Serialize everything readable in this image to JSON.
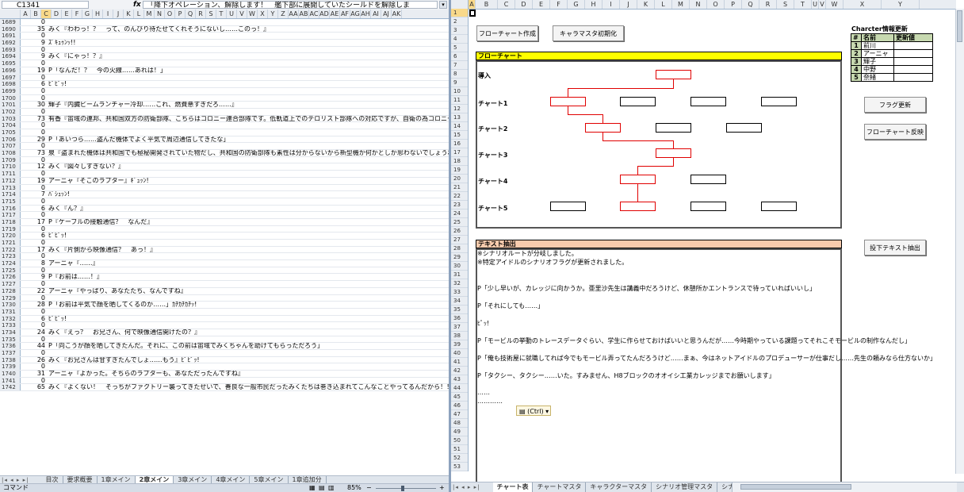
{
  "left": {
    "name_box": "C1341",
    "fx": "fx",
    "formula": "「降下オペレーション、解除します！　艦下部に展開していたシールドを解除しま",
    "columns": [
      "A",
      "B",
      "C",
      "D",
      "E",
      "F",
      "G",
      "H",
      "I",
      "J",
      "K",
      "L",
      "M",
      "N",
      "O",
      "P",
      "Q",
      "R",
      "S",
      "T",
      "U",
      "V",
      "W",
      "X",
      "Y",
      "Z",
      "AA",
      "AB",
      "AC",
      "AD",
      "AE",
      "AF",
      "AG",
      "AH",
      "AI",
      "AJ",
      "AK"
    ],
    "rows": [
      {
        "n": "1689",
        "v": "0",
        "t": ""
      },
      {
        "n": "1690",
        "v": "35",
        "t": "みく『わわっ！？　って、のんびり待たせてくれそうにないし……このっ！』"
      },
      {
        "n": "1691",
        "v": "0",
        "t": ""
      },
      {
        "n": "1692",
        "v": "9",
        "t": "ｽﾞｷｭｩﾝｯ!!"
      },
      {
        "n": "1693",
        "v": "0",
        "t": ""
      },
      {
        "n": "1694",
        "v": "9",
        "t": "みく『にゃっ！？』"
      },
      {
        "n": "1695",
        "v": "0",
        "t": ""
      },
      {
        "n": "1696",
        "v": "19",
        "t": "P「なんだ！？　今の火線……あれは！」"
      },
      {
        "n": "1697",
        "v": "0",
        "t": ""
      },
      {
        "n": "1698",
        "v": "6",
        "t": "ﾋﾟﾋﾟｯ!"
      },
      {
        "n": "1699",
        "v": "0",
        "t": ""
      },
      {
        "n": "1700",
        "v": "0",
        "t": ""
      },
      {
        "n": "1701",
        "v": "30",
        "t": "輝子『内臓ビームランチャー冷却……これ、燃費悪すぎだろ……』"
      },
      {
        "n": "1702",
        "v": "0",
        "t": ""
      },
      {
        "n": "1703",
        "v": "73",
        "t": "有香『宙域の連邦、共和国双方の防衛部隊、こちらはコロニー連合部隊です。低軌道上でのテロリスト部隊への対応ですが、自衛の為コロニー"
      },
      {
        "n": "1704",
        "v": "0",
        "t": ""
      },
      {
        "n": "1705",
        "v": "0",
        "t": ""
      },
      {
        "n": "1706",
        "v": "29",
        "t": "P「あいつら……盗んだ機体でよく平気で周辺通信してきたな」"
      },
      {
        "n": "1707",
        "v": "0",
        "t": ""
      },
      {
        "n": "1708",
        "v": "73",
        "t": "泉『盗まれた機体は共和国でも極秘開発されていた物だし、共和国の防衛部隊も素性は分からないから新型機か何かとしか思わないでしょうね"
      },
      {
        "n": "1709",
        "v": "0",
        "t": ""
      },
      {
        "n": "1710",
        "v": "12",
        "t": "みく『図々しすぎない？』"
      },
      {
        "n": "1711",
        "v": "0",
        "t": ""
      },
      {
        "n": "1712",
        "v": "19",
        "t": "アーニャ『そこのラプター』ｷﾞｭｯﾝ!"
      },
      {
        "n": "1713",
        "v": "0",
        "t": ""
      },
      {
        "n": "1714",
        "v": "7",
        "t": "ﾊﾞｼｭｯﾝ!"
      },
      {
        "n": "1715",
        "v": "0",
        "t": ""
      },
      {
        "n": "1716",
        "v": "6",
        "t": "みく『ん？』"
      },
      {
        "n": "1717",
        "v": "0",
        "t": ""
      },
      {
        "n": "1718",
        "v": "17",
        "t": "P『ケーブルの接触通信？　なんだ』"
      },
      {
        "n": "1719",
        "v": "0",
        "t": ""
      },
      {
        "n": "1720",
        "v": "6",
        "t": "ﾋﾟﾋﾟｯ!"
      },
      {
        "n": "1721",
        "v": "0",
        "t": ""
      },
      {
        "n": "1722",
        "v": "17",
        "t": "みく『片側から映像通信？　あっ！』"
      },
      {
        "n": "1723",
        "v": "0",
        "t": ""
      },
      {
        "n": "1724",
        "v": "8",
        "t": "アーニャ『……』"
      },
      {
        "n": "1725",
        "v": "0",
        "t": ""
      },
      {
        "n": "1726",
        "v": "9",
        "t": "P『お前は……！』"
      },
      {
        "n": "1727",
        "v": "0",
        "t": ""
      },
      {
        "n": "1728",
        "v": "22",
        "t": "アーニャ『やっぱり、あなたたち、なんですね』"
      },
      {
        "n": "1729",
        "v": "0",
        "t": ""
      },
      {
        "n": "1730",
        "v": "28",
        "t": "P「お前は平気で顔を晒してくるのか……」ｶﾁｶﾁｶﾁｯ!"
      },
      {
        "n": "1731",
        "v": "0",
        "t": ""
      },
      {
        "n": "1732",
        "v": "6",
        "t": "ﾋﾟﾋﾟｯ!"
      },
      {
        "n": "1733",
        "v": "0",
        "t": ""
      },
      {
        "n": "1734",
        "v": "24",
        "t": "みく『えっ？　お兄さん、何で映像通信開けたの？』"
      },
      {
        "n": "1735",
        "v": "0",
        "t": ""
      },
      {
        "n": "1736",
        "v": "44",
        "t": "P「向こうが顔を晒してきたんだ。それに、この前は宙域でみくちゃんを助けてもらっただろう」"
      },
      {
        "n": "1737",
        "v": "0",
        "t": ""
      },
      {
        "n": "1738",
        "v": "26",
        "t": "みく『お兄さんは甘すぎたんでしょ……もう』ﾋﾟﾋﾟｯ!"
      },
      {
        "n": "1739",
        "v": "0",
        "t": ""
      },
      {
        "n": "1740",
        "v": "31",
        "t": "アーニャ『よかった。そちらのラプターも、あなただったんですね』"
      },
      {
        "n": "1741",
        "v": "0",
        "t": ""
      },
      {
        "n": "1742",
        "v": "65",
        "t": "みく『よくない！　そっちがファクトリー襲ってきたせいで、善良な一般市民だったみくたちは巻き込まれてこんなことやってるんだから！！』"
      }
    ],
    "tabs": [
      "目次",
      "要求概要",
      "1章メイン",
      "2章メイン",
      "3章メイン",
      "4章メイン",
      "5章メイン",
      "1章追加分"
    ],
    "active_tab": "2章メイン",
    "status_left": "コマンド",
    "zoom": "85%",
    "zoom_minus": "−",
    "zoom_plus": "+"
  },
  "right": {
    "name_box": "A1",
    "columns": [
      "A",
      "B",
      "C",
      "D",
      "E",
      "F",
      "G",
      "H",
      "I",
      "J",
      "K",
      "L",
      "M",
      "N",
      "O",
      "P",
      "Q",
      "R",
      "S",
      "T",
      "U",
      "V",
      "W",
      "X",
      "Y"
    ],
    "row_numbers": [
      "1",
      "2",
      "3",
      "4",
      "5",
      "6",
      "7",
      "8",
      "9",
      "10",
      "11",
      "12",
      "13",
      "14",
      "15",
      "16",
      "17",
      "18",
      "19",
      "20",
      "21",
      "22",
      "23",
      "24",
      "25",
      "26",
      "27",
      "28",
      "29",
      "30",
      "31",
      "32",
      "33",
      "34",
      "35",
      "36",
      "37",
      "38",
      "39",
      "40",
      "41",
      "42",
      "43",
      "44",
      "45",
      "46",
      "47",
      "48",
      "49",
      "50",
      "51",
      "52",
      "53"
    ],
    "buttons": {
      "create_flowchart": "フローチャート作成",
      "init_character_master": "キャラマスタ初期化",
      "update_flags": "フラグ更新",
      "reflect_flowchart": "フローチャート反映",
      "extract_drop_text": "投下テキスト抽出"
    },
    "flowchart_title": "フローチャート",
    "chart_rows": [
      "導入",
      "チャート1",
      "チャート2",
      "チャート3",
      "チャート4",
      "チャート5"
    ],
    "text_extract_title": "テキスト抽出",
    "extract_lines": [
      "※シナリオルートが分岐しました。",
      "※特定アイドルのシナリオフラグが更新されました。",
      "",
      "",
      "P「少し早いが、カレッジに向かうか。亜里沙先生は講義中だろうけど、休憩所かエントランスで待っていればいいし」",
      "",
      "P「それにしても……」",
      "",
      "ﾋﾟｯ!",
      "",
      "P「モービルの挙動のトレースデータぐらい、学生に作らせておけばいいと思うんだが……今時期やっている課題ってそれこそモービルの制作なんだし」",
      "",
      "P「俺も技術屋に就職してれば今でもモービル弄ってたんだろうけど……まぁ、今はネットアイドルのプロデューサーが仕事だし……先生の頼みなら仕方ないか」",
      "",
      "P「タクシー、タクシー……いた。すみません、H8ブロックのオオイシ工業カレッジまでお願いします」",
      "",
      "……",
      "…………"
    ],
    "character_table": {
      "title": "Charcter情報更新",
      "headers": [
        "#",
        "名前",
        "更新値"
      ],
      "rows": [
        {
          "no": "1",
          "name": "前川",
          "val": ""
        },
        {
          "no": "2",
          "name": "アーニャ",
          "val": ""
        },
        {
          "no": "3",
          "name": "輝子",
          "val": ""
        },
        {
          "no": "4",
          "name": "中野",
          "val": ""
        },
        {
          "no": "5",
          "name": "奈緒",
          "val": ""
        }
      ]
    },
    "paste_chip": "(Ctrl)",
    "tabs": [
      "チャート表",
      "チャートマスタ",
      "キャラクターマスタ",
      "シナリオ管理マスタ",
      "シナ"
    ],
    "active_tab": "チャート表"
  },
  "colors": {
    "flowchart_header": "#ffff00",
    "text_header": "#f8cbad",
    "path_red": "#e00000",
    "table_header": "#c7d9b0"
  }
}
